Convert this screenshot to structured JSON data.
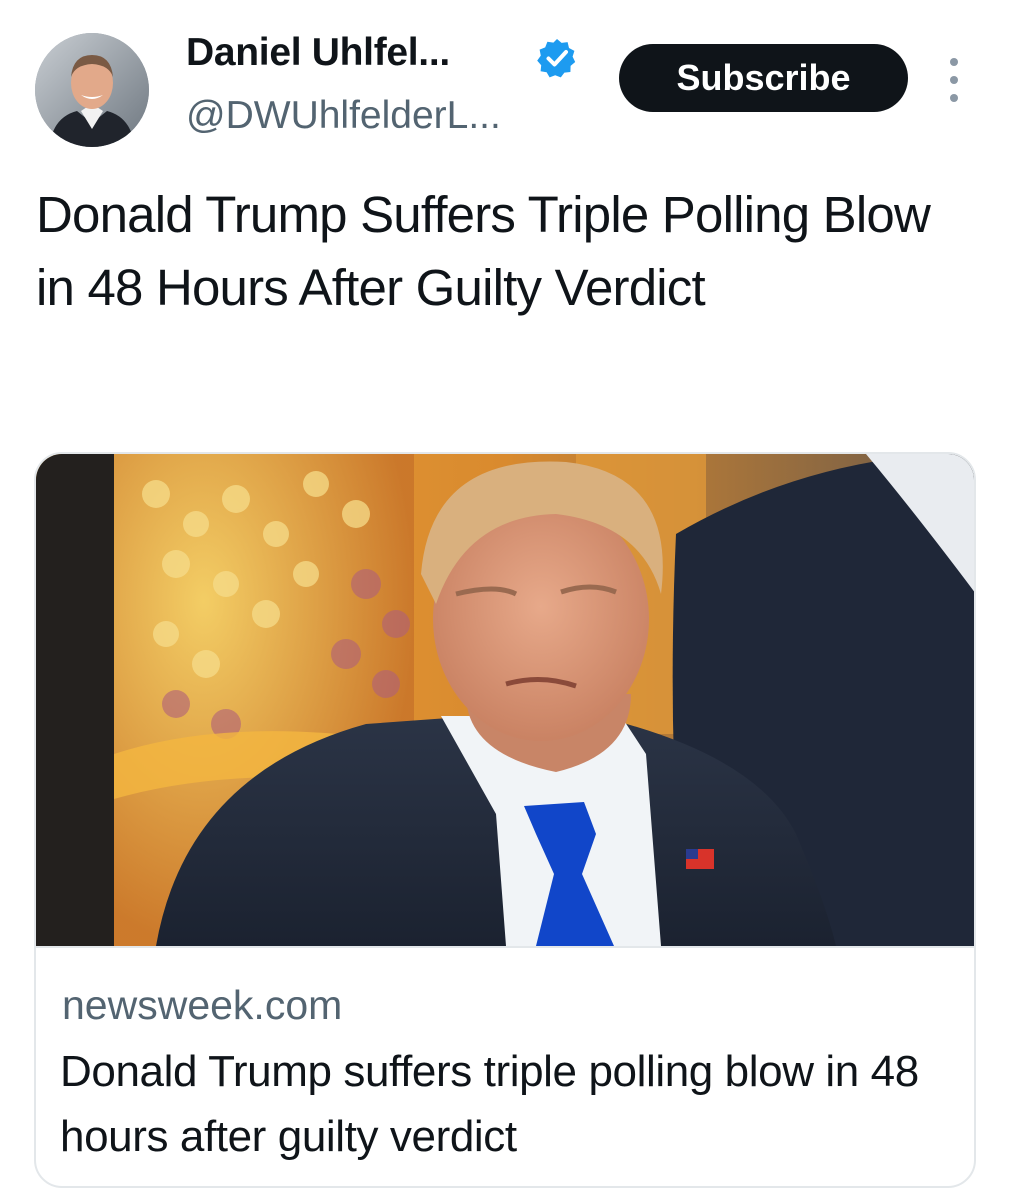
{
  "author": {
    "display_name": "Daniel Uhlfel...",
    "handle": "@DWUhlfelderL...",
    "verified": true,
    "avatar": "avatar-photo"
  },
  "header": {
    "subscribe_label": "Subscribe",
    "more_icon": "more-vertical-icon"
  },
  "tweet": {
    "text": "Donald Trump Suffers Triple Polling Blow in 48 Hours After Guilty Verdict"
  },
  "card": {
    "image": "news-photo",
    "domain": "newsweek.com",
    "title": "Donald Trump suffers triple polling blow in 48 hours after guilty verdict"
  },
  "colors": {
    "verified_badge": "#1d9bf0",
    "subscribe_bg": "#0f1419",
    "secondary_text": "#536471",
    "card_border": "#e3e7ea"
  }
}
